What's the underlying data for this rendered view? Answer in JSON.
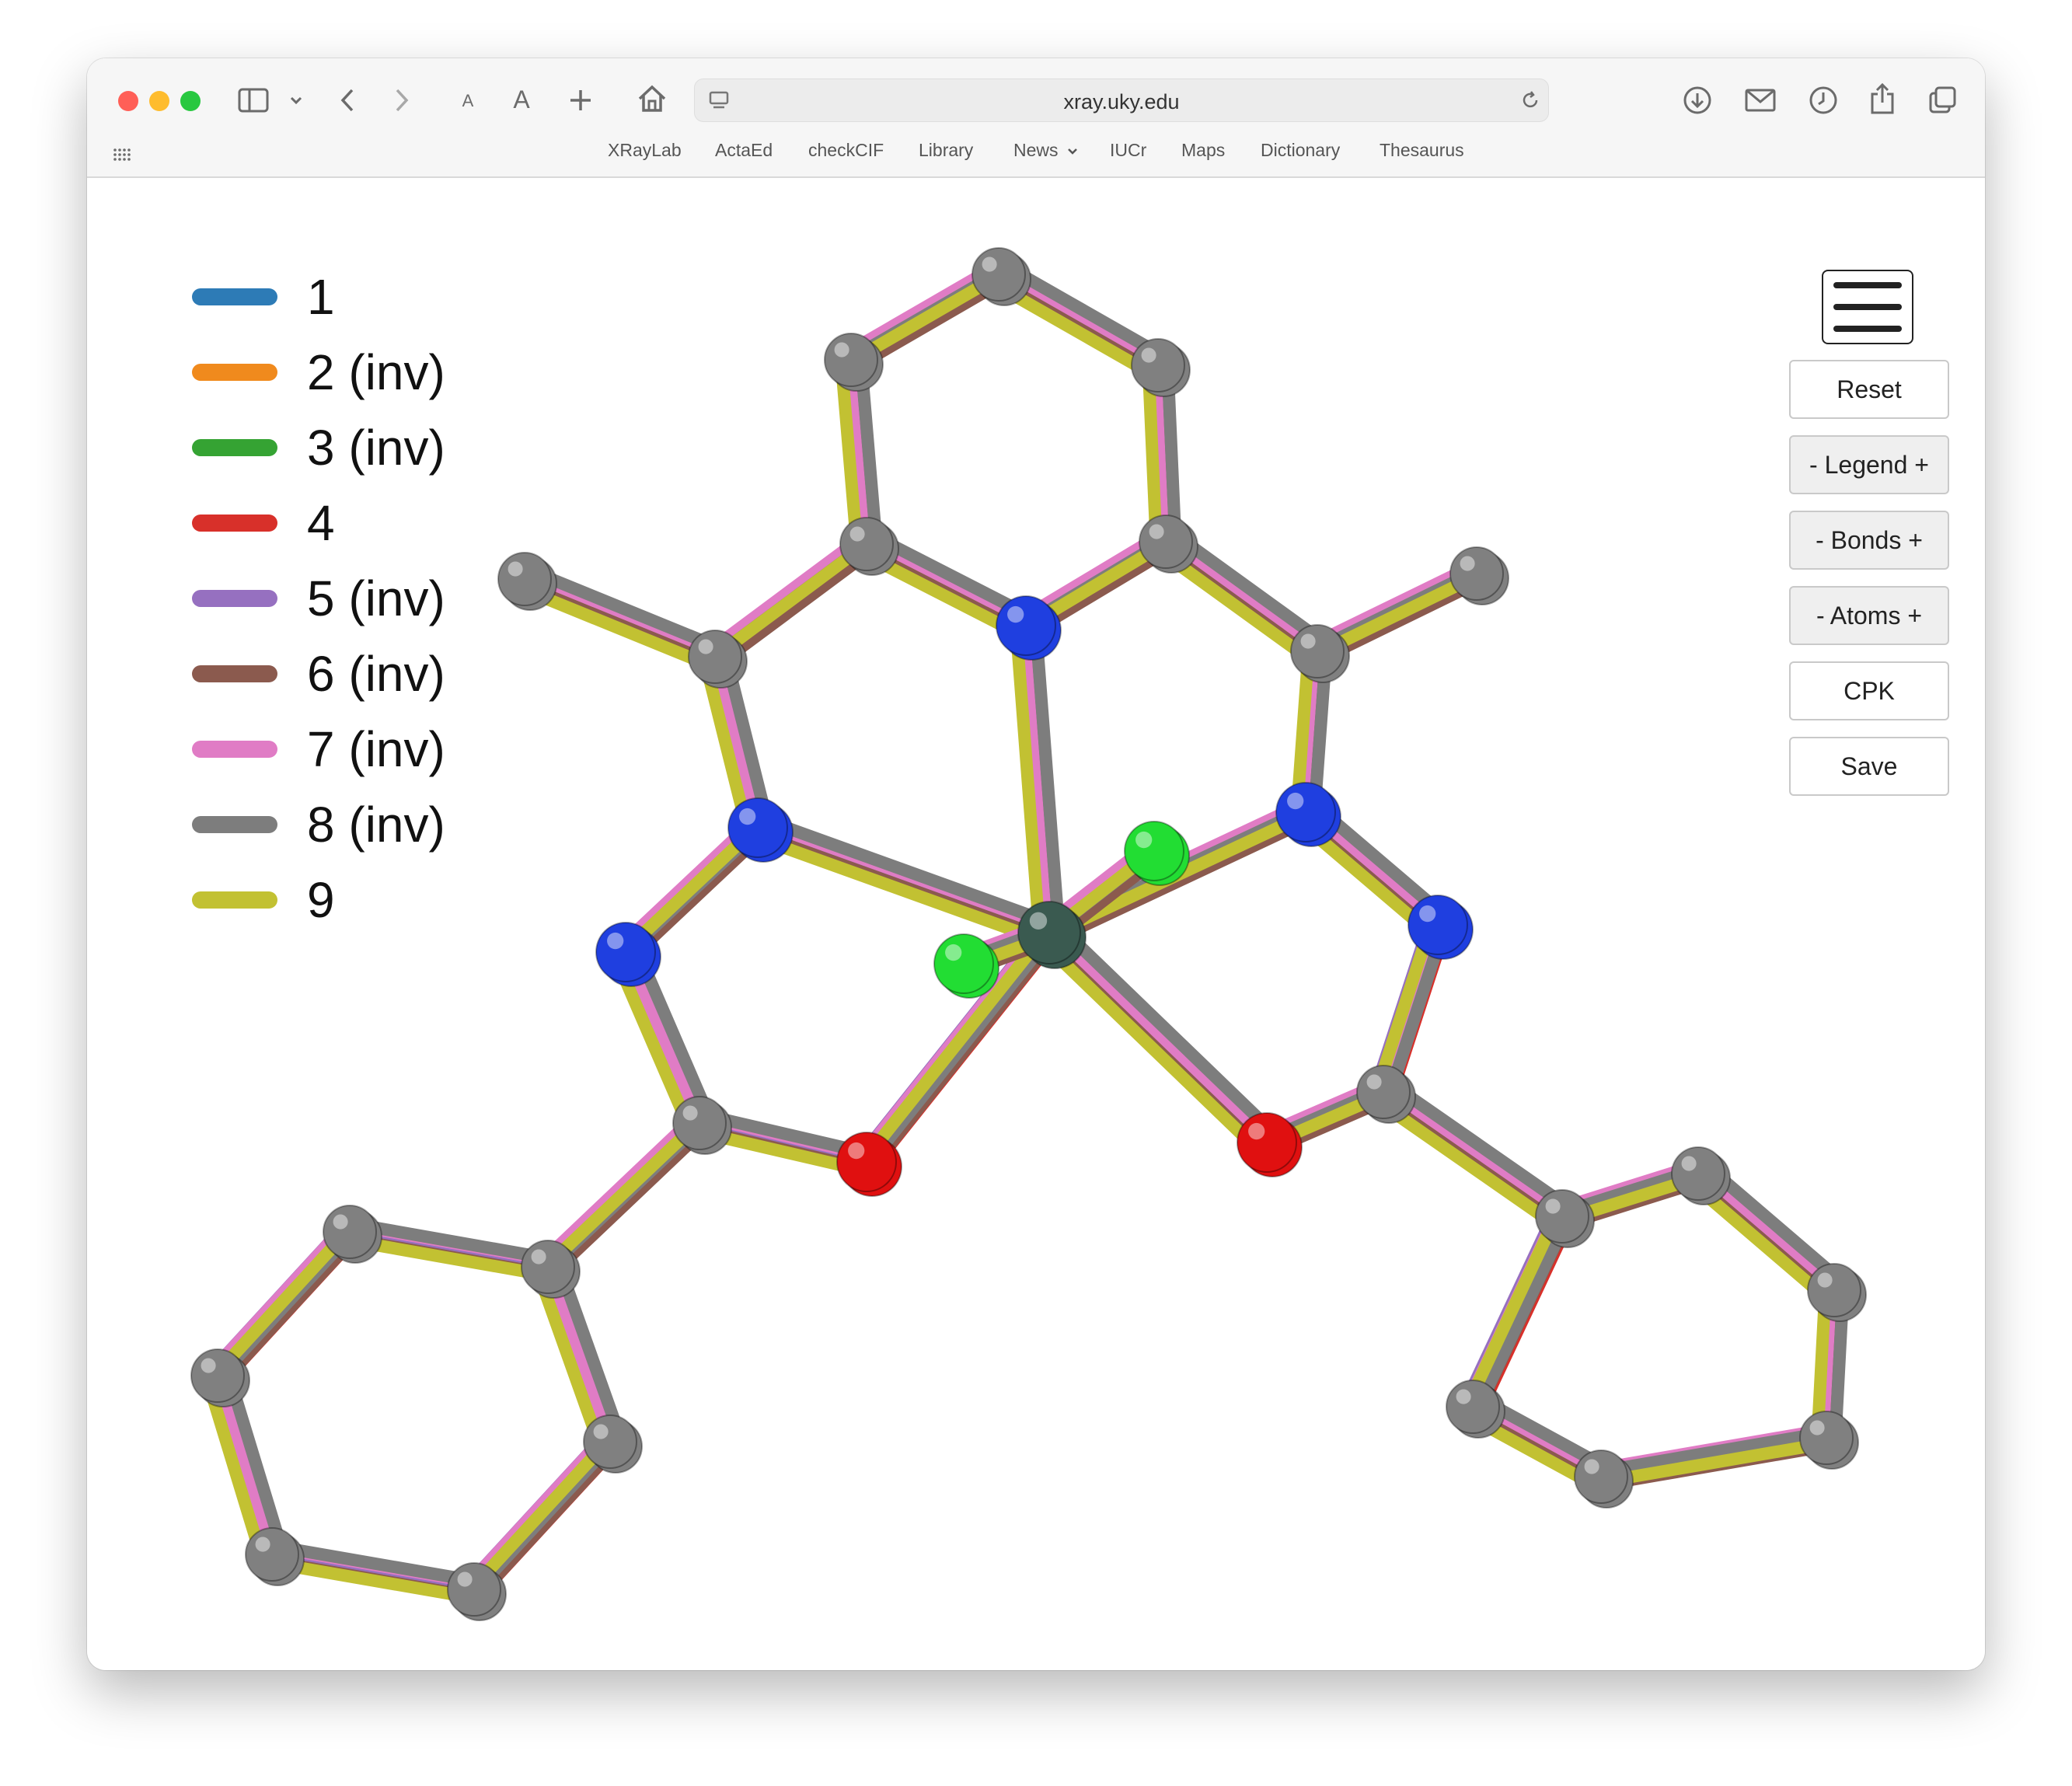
{
  "browser": {
    "url": "xray.uky.edu",
    "traffic_lights": {
      "close": "#ff5f57",
      "minimize": "#febc2e",
      "zoom": "#28c840"
    },
    "toolbar_icons": [
      "sidebar-icon",
      "chevron-down-icon",
      "back-icon",
      "forward-icon",
      "text-smaller-icon",
      "text-larger-icon",
      "new-tab-icon",
      "home-icon",
      "page-icon",
      "reload-icon",
      "download-icon",
      "mail-icon",
      "history-icon",
      "share-icon",
      "tabs-icon",
      "grid-icon"
    ],
    "text_size_small": "A",
    "text_size_large": "A",
    "bookmarks": [
      "XRayLab",
      "ActaEd",
      "checkCIF",
      "Library",
      "News",
      "IUCr",
      "Maps",
      "Dictionary",
      "Thesaurus"
    ]
  },
  "viewer": {
    "legend": [
      {
        "label": "1",
        "color": "#2d7bb6"
      },
      {
        "label": "2 (inv)",
        "color": "#f08a1d"
      },
      {
        "label": "3 (inv)",
        "color": "#35a333"
      },
      {
        "label": "4",
        "color": "#d8302a"
      },
      {
        "label": "5 (inv)",
        "color": "#9670c0"
      },
      {
        "label": "6 (inv)",
        "color": "#8b5a4e"
      },
      {
        "label": "7 (inv)",
        "color": "#e07cc5"
      },
      {
        "label": "8 (inv)",
        "color": "#7d7d7d"
      },
      {
        "label": "9",
        "color": "#c2c132"
      }
    ],
    "buttons": {
      "reset": "Reset",
      "legend": "- Legend +",
      "bonds": "- Bonds +",
      "atoms": "- Atoms +",
      "cpk": "CPK",
      "save": "Save"
    },
    "menu_icon": "hamburger-menu-icon",
    "atom_colors": {
      "carbon": "#808080",
      "nitrogen": "#1f3fe0",
      "oxygen": "#e01010",
      "chlorine": "#22dd33",
      "metal": "#3a5a50"
    }
  }
}
